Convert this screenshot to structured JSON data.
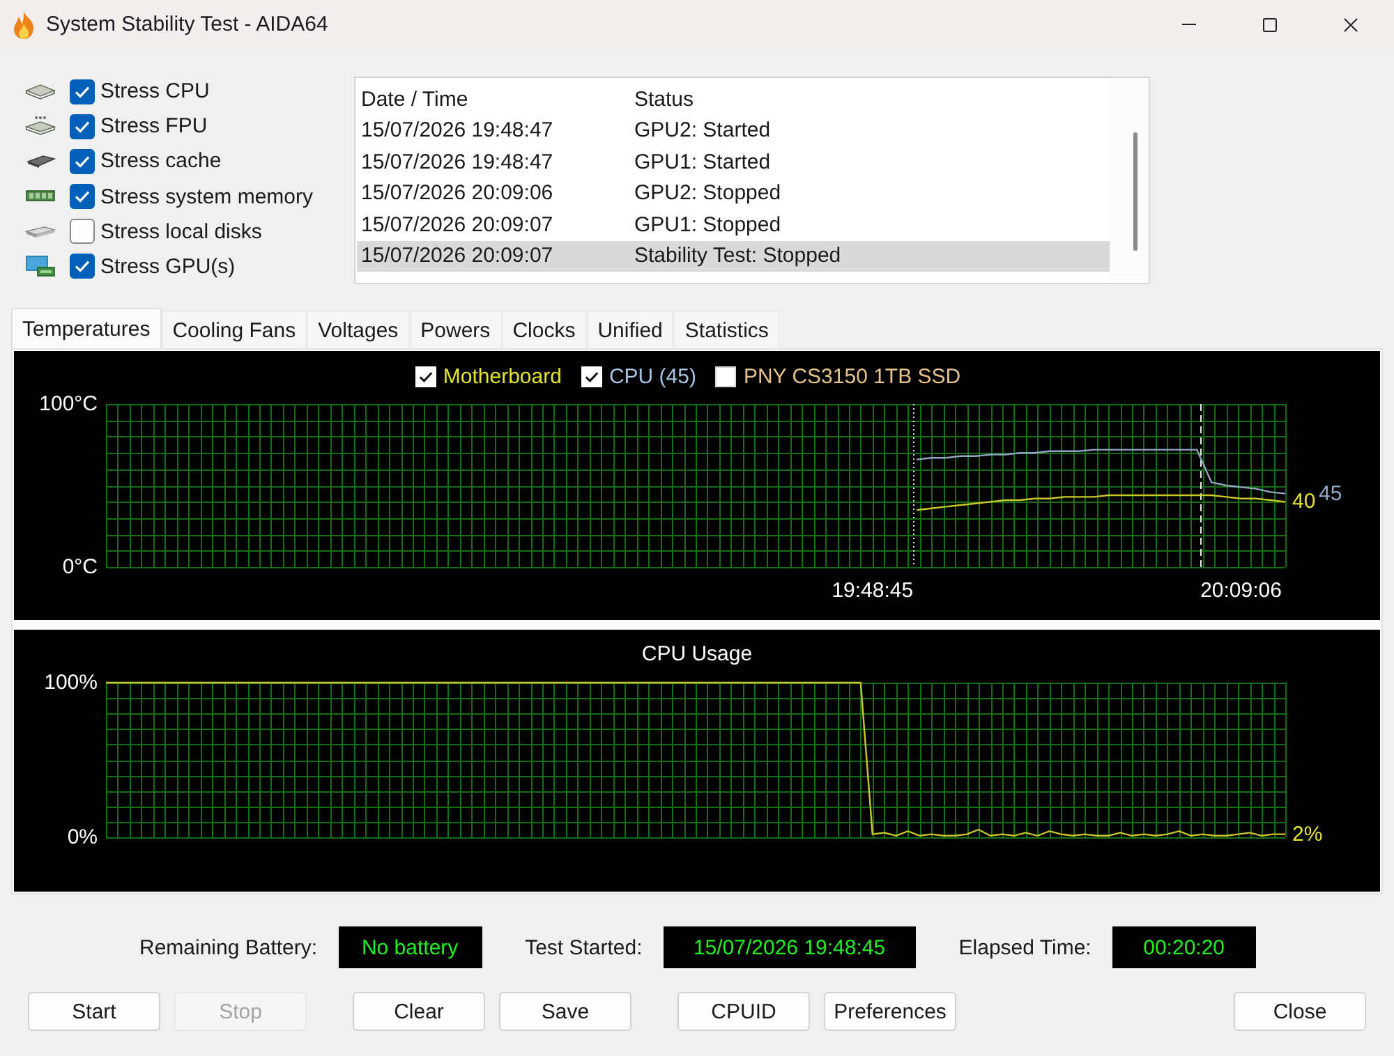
{
  "window": {
    "title": "System Stability Test - AIDA64"
  },
  "stress_options": [
    {
      "kind": "cpu",
      "label": "Stress CPU",
      "checked": true
    },
    {
      "kind": "fpu",
      "label": "Stress FPU",
      "checked": true
    },
    {
      "kind": "cache",
      "label": "Stress cache",
      "checked": true
    },
    {
      "kind": "memory",
      "label": "Stress system memory",
      "checked": true
    },
    {
      "kind": "disk",
      "label": "Stress local disks",
      "checked": false
    },
    {
      "kind": "gpu",
      "label": "Stress GPU(s)",
      "checked": true
    }
  ],
  "log": {
    "columns": [
      "Date / Time",
      "Status"
    ],
    "rows": [
      {
        "cells": [
          "15/07/2026 19:48:47",
          "GPU2: Started"
        ],
        "selected": false
      },
      {
        "cells": [
          "15/07/2026 19:48:47",
          "GPU1: Started"
        ],
        "selected": false
      },
      {
        "cells": [
          "15/07/2026 20:09:06",
          "GPU2: Stopped"
        ],
        "selected": false
      },
      {
        "cells": [
          "15/07/2026 20:09:07",
          "GPU1: Stopped"
        ],
        "selected": false
      },
      {
        "cells": [
          "15/07/2026 20:09:07",
          "Stability Test: Stopped"
        ],
        "selected": true
      }
    ]
  },
  "tabs": [
    {
      "label": "Temperatures",
      "selected": true
    },
    {
      "label": "Cooling Fans",
      "selected": false
    },
    {
      "label": "Voltages",
      "selected": false
    },
    {
      "label": "Powers",
      "selected": false
    },
    {
      "label": "Clocks",
      "selected": false
    },
    {
      "label": "Unified",
      "selected": false
    },
    {
      "label": "Statistics",
      "selected": false
    }
  ],
  "temperature_graph": {
    "legend": [
      {
        "label": "Motherboard",
        "checked": true,
        "color": "#e4e42a"
      },
      {
        "label": "CPU (45)",
        "checked": true,
        "color": "#a8c2e4"
      },
      {
        "label": "PNY CS3150 1TB SSD",
        "checked": false,
        "color": "#e6c38c"
      }
    ],
    "readings": [
      {
        "text": "40"
      },
      {
        "text": "45"
      }
    ],
    "chart_data": {
      "type": "line",
      "grid": true,
      "categories": [
        null,
        null,
        null,
        null,
        null,
        null,
        null,
        null,
        null,
        null,
        null,
        null,
        null,
        null,
        null,
        null,
        null,
        null,
        null,
        null,
        null,
        null,
        null,
        null,
        null,
        null,
        null,
        null,
        null,
        null,
        null,
        null,
        null,
        null,
        null,
        null,
        null,
        null,
        null,
        null,
        null,
        null,
        null,
        null,
        null,
        null,
        null,
        null,
        null,
        null,
        null,
        null,
        "19:48:45",
        null,
        null,
        null,
        null,
        null,
        null,
        null,
        null,
        null,
        null,
        null,
        null,
        null,
        null,
        null,
        null,
        null,
        null,
        null,
        null,
        null,
        null,
        null,
        null,
        "20:09:06",
        null,
        null,
        null
      ],
      "ylim": [
        0,
        100
      ],
      "yticks": [
        {
          "value": 0,
          "label": "0°C"
        },
        {
          "value": 100,
          "label": "100°C"
        }
      ],
      "series": [
        {
          "color": "#c8c82a",
          "values": [
            null,
            null,
            null,
            null,
            null,
            null,
            null,
            null,
            null,
            null,
            null,
            null,
            null,
            null,
            null,
            null,
            null,
            null,
            null,
            null,
            null,
            null,
            null,
            null,
            null,
            null,
            null,
            null,
            null,
            null,
            null,
            null,
            null,
            null,
            null,
            null,
            null,
            null,
            null,
            null,
            null,
            null,
            null,
            null,
            null,
            null,
            null,
            null,
            null,
            null,
            null,
            null,
            null,
            null,
            null,
            35,
            36,
            37,
            38,
            39,
            40,
            41,
            41,
            42,
            42,
            43,
            43,
            43,
            44,
            44,
            44,
            44,
            44,
            44,
            44,
            44,
            43,
            42,
            42,
            41,
            40
          ]
        },
        {
          "color": "#8fa6c4",
          "values": [
            null,
            null,
            null,
            null,
            null,
            null,
            null,
            null,
            null,
            null,
            null,
            null,
            null,
            null,
            null,
            null,
            null,
            null,
            null,
            null,
            null,
            null,
            null,
            null,
            null,
            null,
            null,
            null,
            null,
            null,
            null,
            null,
            null,
            null,
            null,
            null,
            null,
            null,
            null,
            null,
            null,
            null,
            null,
            null,
            null,
            null,
            null,
            null,
            null,
            null,
            null,
            null,
            null,
            null,
            null,
            66,
            67,
            67,
            68,
            68,
            69,
            69,
            70,
            70,
            71,
            71,
            71,
            72,
            72,
            72,
            72,
            72,
            72,
            72,
            72,
            52,
            50,
            49,
            48,
            46,
            45
          ]
        }
      ]
    }
  },
  "cpu_usage_graph": {
    "readings": [
      {
        "text": "2%"
      }
    ],
    "chart_data": {
      "type": "line",
      "title": "CPU Usage",
      "grid": true,
      "categories": [
        null,
        null,
        null,
        null,
        null,
        null,
        null,
        null,
        null,
        null,
        null,
        null,
        null,
        null,
        null,
        null,
        null,
        null,
        null,
        null,
        null,
        null,
        null,
        null,
        null,
        null,
        null,
        null,
        null,
        null,
        null,
        null,
        null,
        null,
        null,
        null,
        null,
        null,
        null,
        null,
        null,
        null,
        null,
        null,
        null,
        null,
        null,
        null,
        null,
        null,
        null,
        null,
        null,
        null,
        null,
        null,
        null,
        null,
        null,
        null,
        null,
        null,
        null,
        null,
        null,
        null,
        null,
        null,
        null,
        null,
        null,
        null,
        null,
        null,
        null,
        null,
        null,
        null,
        null,
        null,
        null,
        null,
        null,
        null,
        null,
        null,
        null,
        null,
        null,
        null,
        null,
        null,
        null,
        null,
        null,
        null,
        null,
        null,
        null,
        null,
        null
      ],
      "ylim": [
        0,
        100
      ],
      "yticks": [
        {
          "value": 0,
          "label": "0%"
        },
        {
          "value": 100,
          "label": "100%"
        }
      ],
      "series": [
        {
          "color": "#c8c82a",
          "values": [
            100,
            100,
            100,
            100,
            100,
            100,
            100,
            100,
            100,
            100,
            100,
            100,
            100,
            100,
            100,
            100,
            100,
            100,
            100,
            100,
            100,
            100,
            100,
            100,
            100,
            100,
            100,
            100,
            100,
            100,
            100,
            100,
            100,
            100,
            100,
            100,
            100,
            100,
            100,
            100,
            100,
            100,
            100,
            100,
            100,
            100,
            100,
            100,
            100,
            100,
            100,
            100,
            100,
            100,
            100,
            100,
            100,
            100,
            100,
            100,
            100,
            100,
            100,
            100,
            100,
            2,
            3,
            1,
            4,
            1,
            2,
            1,
            1,
            2,
            5,
            1,
            2,
            1,
            3,
            1,
            4,
            2,
            1,
            2,
            1,
            1,
            3,
            1,
            2,
            1,
            2,
            4,
            1,
            2,
            1,
            1,
            2,
            3,
            1,
            2,
            2
          ]
        }
      ]
    }
  },
  "status": [
    {
      "label": "Remaining Battery:",
      "value": "No battery"
    },
    {
      "label": "Test Started:",
      "value": "15/07/2026 19:48:45"
    },
    {
      "label": "Elapsed Time:",
      "value": "00:20:20"
    }
  ],
  "buttons": [
    {
      "label": "Start",
      "disabled": false
    },
    {
      "label": "Stop",
      "disabled": true
    },
    {
      "label": "Clear",
      "disabled": false
    },
    {
      "label": "Save",
      "disabled": false
    },
    {
      "label": "CPUID",
      "disabled": false
    },
    {
      "label": "Preferences",
      "disabled": false
    },
    {
      "label": "Close",
      "disabled": false
    }
  ]
}
